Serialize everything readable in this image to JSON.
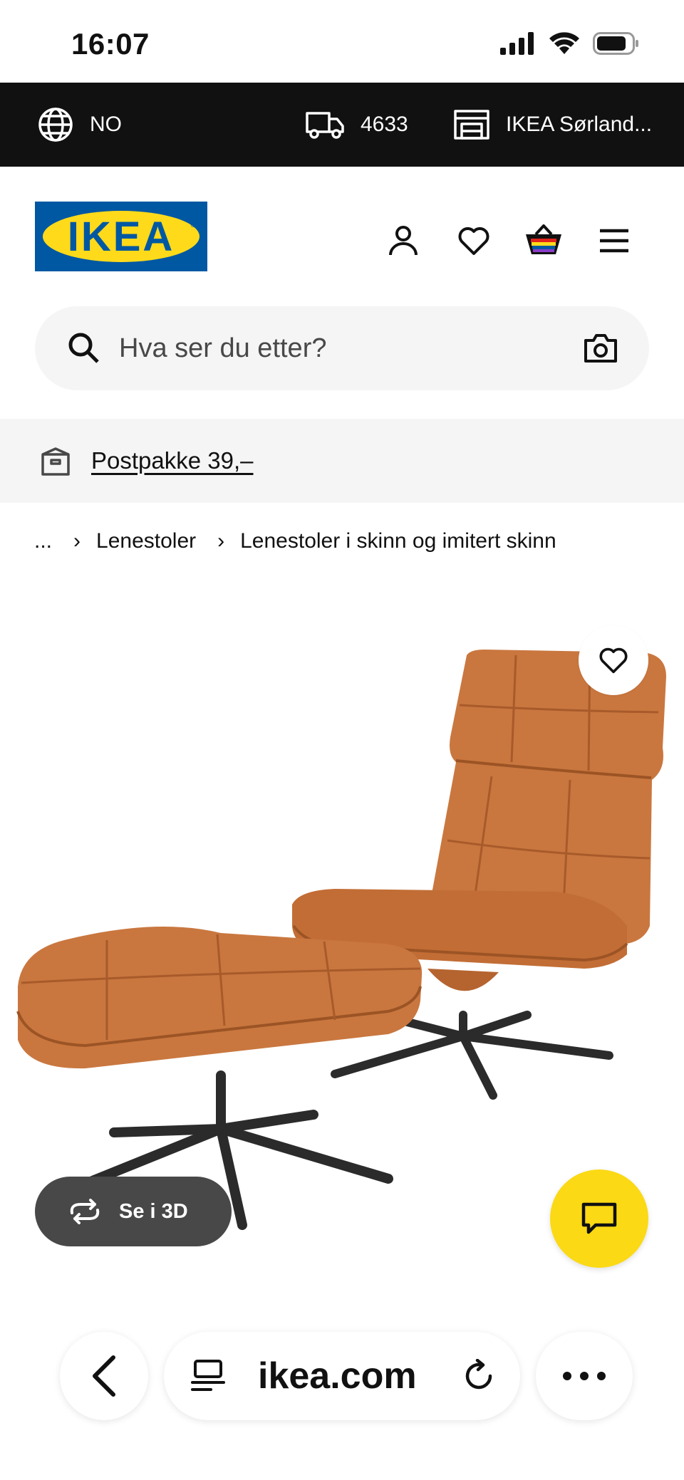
{
  "status_bar": {
    "time": "16:07"
  },
  "topbar": {
    "language": "NO",
    "postcode": "4633",
    "store": "IKEA Sørland..."
  },
  "header": {
    "logo_text": "IKEA"
  },
  "search": {
    "placeholder": "Hva ser du etter?"
  },
  "banner": {
    "text": "Postpakke 39,–"
  },
  "breadcrumb": {
    "ellipsis": "...",
    "items": [
      "Lenestoler",
      "Lenestoler i skinn og imitert skinn"
    ]
  },
  "product": {
    "view_3d_label": "Se i 3D",
    "image_alt": "Orange leather swivel armchair with matching footstool on black star bases",
    "colors": {
      "leather": "#c9773f",
      "leather_dark": "#a85a2a",
      "base": "#2b2b2b"
    }
  },
  "browser": {
    "url": "ikea.com"
  },
  "colors": {
    "brand_blue": "#0058a3",
    "brand_yellow": "#ffda1a",
    "chat_yellow": "#fbd914",
    "topbar_bg": "#111111"
  }
}
